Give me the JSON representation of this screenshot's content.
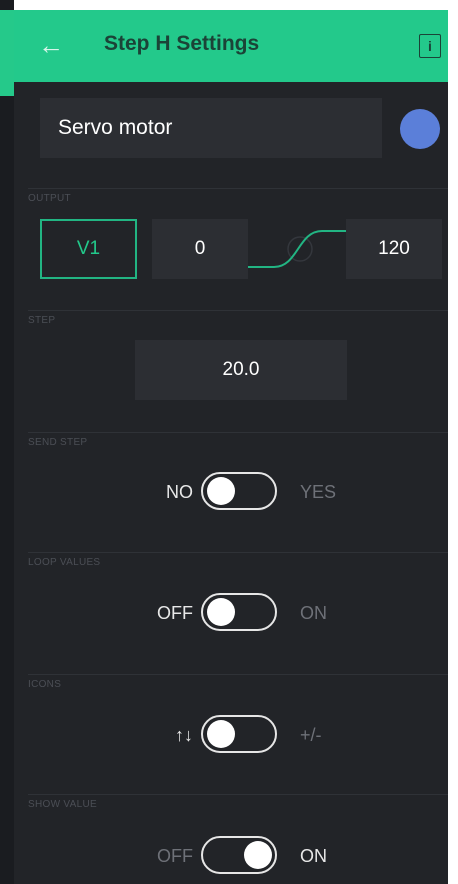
{
  "header": {
    "back_icon": "arrow-left-icon",
    "title": "Step H Settings",
    "info_icon": "info-icon",
    "info_glyph": "i",
    "accent_color": "#23c98b"
  },
  "widget": {
    "name_value": "Servo motor",
    "color": "#5b7fd9"
  },
  "output": {
    "label": "OUTPUT",
    "pin": "V1",
    "min": "0",
    "max": "120"
  },
  "step": {
    "label": "STEP",
    "value": "20.0"
  },
  "send_step": {
    "label": "SEND STEP",
    "left": "NO",
    "right": "YES",
    "state": "off"
  },
  "loop_values": {
    "label": "LOOP VALUES",
    "left": "OFF",
    "right": "ON",
    "state": "off"
  },
  "icons": {
    "label": "ICONS",
    "left": "↑↓",
    "right": "+/-",
    "state": "off"
  },
  "show_value": {
    "label": "SHOW VALUE",
    "left": "OFF",
    "right": "ON",
    "state": "on"
  }
}
